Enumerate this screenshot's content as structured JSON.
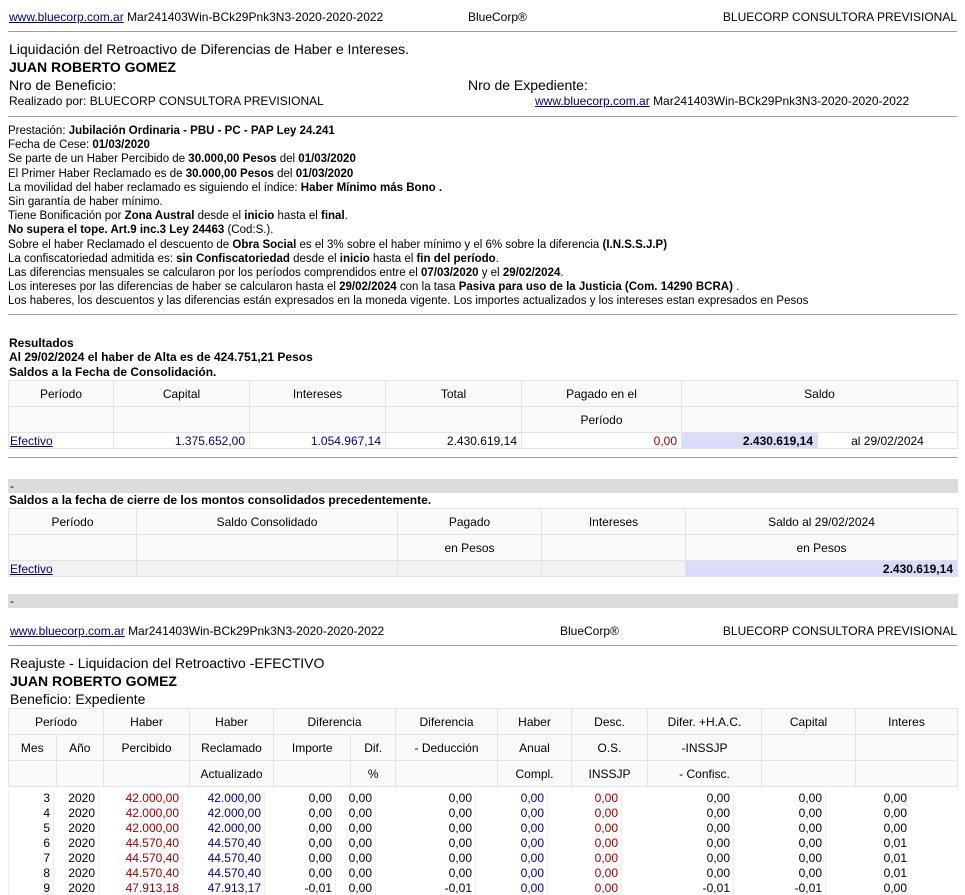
{
  "header": {
    "link": "www.bluecorp.com.ar",
    "code": "Mar241403Win-BCk29Pnk3N3-2020-2020-2022",
    "brand": "BlueCorp®",
    "consultora": "BLUECORP CONSULTORA PREVISIONAL"
  },
  "doc": {
    "title": "Liquidación del Retroactivo de Diferencias de Haber e Intereses.",
    "name": "JUAN ROBERTO GOMEZ",
    "beneficio_label": "Nro de Beneficio:",
    "expediente_label": "Nro de Expediente:",
    "realizado": "Realizado por: BLUECORP CONSULTORA PREVISIONAL",
    "realizado_link": "www.bluecorp.com.ar",
    "realizado_code": "Mar241403Win-BCk29Pnk3N3-2020-2020-2022"
  },
  "details": [
    [
      "Prestación: ",
      {
        "b": "Jubilación Ordinaria - PBU - PC - PAP Ley 24.241"
      }
    ],
    [
      "Fecha de Cese: ",
      {
        "b": "01/03/2020"
      }
    ],
    [
      "Se parte de un Haber Percibido de ",
      {
        "b": "30.000,00 Pesos"
      },
      " del ",
      {
        "b": "01/03/2020"
      }
    ],
    [
      "El Primer Haber Reclamado es de ",
      {
        "b": "30.000,00 Pesos"
      },
      " del ",
      {
        "b": "01/03/2020"
      }
    ],
    [
      "La movilidad del haber reclamado es siguiendo el índice: ",
      {
        "b": "Haber Mínimo más Bono ."
      }
    ],
    [
      "Sin garantía de haber mínimo."
    ],
    [
      "Tiene Bonificación por ",
      {
        "b": "Zona Austral"
      },
      " desde el ",
      {
        "b": "inicio"
      },
      " hasta el ",
      {
        "b": "final"
      },
      "."
    ],
    [
      {
        "b": "No supera el tope. Art.9 inc.3 Ley 24463"
      },
      " (Cod:S.)."
    ],
    [
      "Sobre el haber Reclamado el descuento de ",
      {
        "b": "Obra Social"
      },
      " es el 3% sobre el haber mínimo y el 6% sobre la diferencia ",
      {
        "b": "(I.N.S.S.J.P)"
      }
    ],
    [
      "La confiscatoriedad admitida es: ",
      {
        "b": "sin Confiscatoriedad"
      },
      " desde el ",
      {
        "b": "inicio"
      },
      " hasta el ",
      {
        "b": "fin del período"
      },
      "."
    ],
    [
      "Las diferencias mensuales se calcularon por los períodos comprendidos entre el ",
      {
        "b": "07/03/2020"
      },
      " y el ",
      {
        "b": "29/02/2024"
      },
      "."
    ],
    [
      "Los intereses por las diferencias de haber se calcularon hasta el ",
      {
        "b": "29/02/2024"
      },
      " con la tasa ",
      {
        "b": "Pasiva para uso de la Justicia (Com. 14290 BCRA)"
      },
      " ."
    ],
    [
      "Los haberes, los descuentos y las diferencias están expresados en la moneda vigente. Los importes actualizados y los intereses estan expresados en Pesos"
    ]
  ],
  "resultados": {
    "title": "Resultados",
    "alta": "Al 29/02/2024 el haber de Alta es de 424.751,21 Pesos",
    "saldos_title": "Saldos a la Fecha de Consolidación.",
    "headers": [
      "Período",
      "Capital",
      "Intereses",
      "Total",
      "Pagado en el",
      "Saldo"
    ],
    "header2": "Período",
    "row": {
      "periodo": "Efectivo",
      "capital": "1.375.652,00",
      "intereses": "1.054.967,14",
      "total": "2.430.619,14",
      "pagado": "0,00",
      "saldo": "2.430.619,14",
      "fecha": "al 29/02/2024"
    }
  },
  "cierre": {
    "dash1": "-",
    "title": "Saldos a la fecha de cierre de los montos consolidados precedentemente.",
    "headers": [
      "Período",
      "Saldo Consolidado",
      "Pagado",
      "Intereses",
      "Saldo al 29/02/2024"
    ],
    "sub": [
      "en Pesos",
      "en Pesos"
    ],
    "row": {
      "periodo": "Efectivo",
      "saldo": "2.430.619,14"
    },
    "dash2": "-"
  },
  "reajuste": {
    "title": "Reajuste - Liquidacion del Retroactivo -EFECTIVO",
    "name": "JUAN ROBERTO GOMEZ",
    "beneficio": "Beneficio: Expediente",
    "h1": [
      "Período",
      "Haber",
      "Haber",
      "Diferencia",
      "Diferencia",
      "Haber",
      "Desc.",
      "Difer. +H.A.C.",
      "Capital",
      "Interes"
    ],
    "h2": [
      "Mes",
      "Año",
      "Percibido",
      "Reclamado",
      "Importe",
      "Dif.",
      "- Deducción",
      "Anual",
      "O.S.",
      "-INSSJP"
    ],
    "h3": [
      "Actualizado",
      "%",
      "Compl.",
      "INSSJP",
      "- Confisc."
    ],
    "rows": [
      [
        "3",
        "2020",
        "42.000,00",
        "42.000,00",
        "0,00",
        "0,00",
        "0,00",
        "0,00",
        "0,00",
        "0,00",
        "0,00",
        "0,00"
      ],
      [
        "4",
        "2020",
        "42.000,00",
        "42.000,00",
        "0,00",
        "0,00",
        "0,00",
        "0,00",
        "0,00",
        "0,00",
        "0,00",
        "0,00"
      ],
      [
        "5",
        "2020",
        "42.000,00",
        "42.000,00",
        "0,00",
        "0,00",
        "0,00",
        "0,00",
        "0,00",
        "0,00",
        "0,00",
        "0,00"
      ],
      [
        "6",
        "2020",
        "44.570,40",
        "44.570,40",
        "0,00",
        "0,00",
        "0,00",
        "0,00",
        "0,00",
        "0,00",
        "0,00",
        "0,01"
      ],
      [
        "7",
        "2020",
        "44.570,40",
        "44.570,40",
        "0,00",
        "0,00",
        "0,00",
        "0,00",
        "0,00",
        "0,00",
        "0,00",
        "0,01"
      ],
      [
        "8",
        "2020",
        "44.570,40",
        "44.570,40",
        "0,00",
        "0,00",
        "0,00",
        "0,00",
        "0,00",
        "0,00",
        "0,00",
        "0,01"
      ],
      [
        "9",
        "2020",
        "47.913,18",
        "47.913,17",
        "-0,01",
        "0,00",
        "-0,01",
        "0,00",
        "0,00",
        "-0,01",
        "-0,01",
        "0,00"
      ]
    ]
  }
}
